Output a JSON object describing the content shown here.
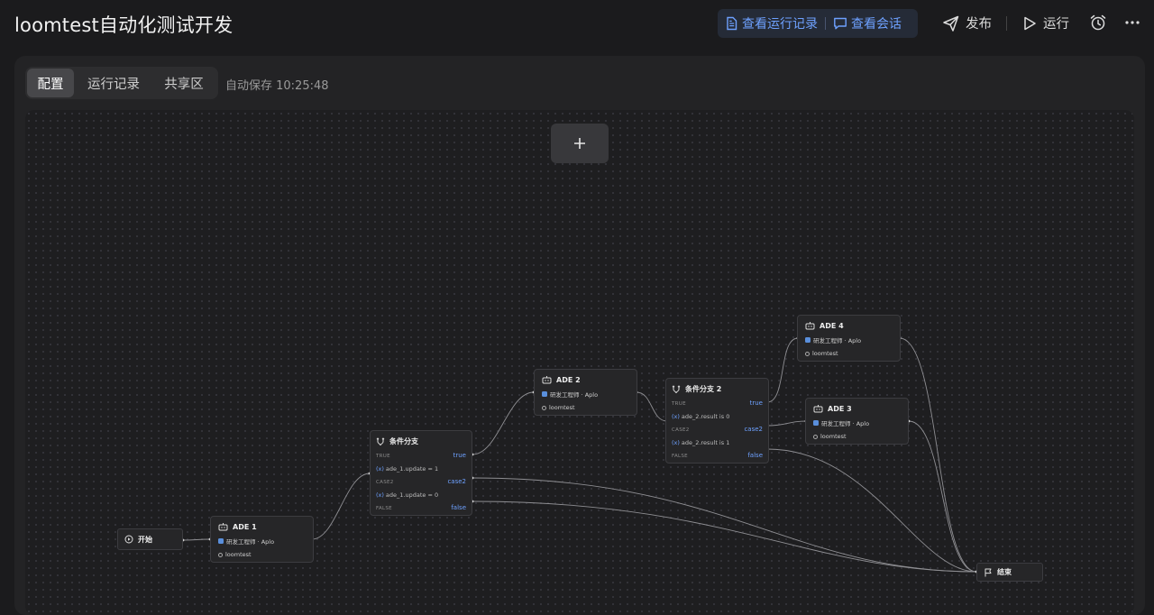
{
  "app": {
    "title": "loomtest自动化测试开发"
  },
  "header": {
    "view_runs_label": "查看运行记录",
    "view_chat_label": "查看会话",
    "publish_label": "发布",
    "run_label": "运行"
  },
  "tabs": [
    {
      "label": "配置",
      "active": true
    },
    {
      "label": "运行记录",
      "active": false
    },
    {
      "label": "共享区",
      "active": false
    }
  ],
  "autosave": "自动保存 10:25:48",
  "canvas": {
    "add_symbol": "+",
    "start_label": "开始",
    "end_label": "结束",
    "ade_nodes": [
      {
        "title": "ADE 1",
        "role": "研发工程师 · Aplo",
        "project": "loomtest"
      },
      {
        "title": "ADE 2",
        "role": "研发工程师 · Aplo",
        "project": "loomtest"
      },
      {
        "title": "ADE 3",
        "role": "研发工程师 · Aplo",
        "project": "loomtest"
      },
      {
        "title": "ADE 4",
        "role": "研发工程师 · Aplo",
        "project": "loomtest"
      }
    ],
    "condition_nodes": [
      {
        "title": "条件分支",
        "cases": [
          {
            "case": "TRUE",
            "output": "true",
            "condition": "ade_1.update = 1"
          },
          {
            "case": "CASE2",
            "output": "case2",
            "condition": "ade_1.update = 0"
          },
          {
            "case": "FALSE",
            "output": "false",
            "condition": ""
          }
        ]
      },
      {
        "title": "条件分支 2",
        "cases": [
          {
            "case": "TRUE",
            "output": "true",
            "condition": "ade_2.result is 0"
          },
          {
            "case": "CASE2",
            "output": "case2",
            "condition": "ade_2.result is 1"
          },
          {
            "case": "FALSE",
            "output": "false",
            "condition": ""
          }
        ]
      }
    ],
    "fx_symbol": "(x)"
  },
  "colors": {
    "accent": "#6ea1ff",
    "background": "#1b1b1d",
    "node": "#262628"
  },
  "icons": [
    "file-icon",
    "chat-icon",
    "send-icon",
    "play-icon",
    "alarm-icon",
    "more-icon",
    "plus-icon",
    "robot-icon",
    "branch-icon",
    "flag-icon",
    "start-icon"
  ]
}
